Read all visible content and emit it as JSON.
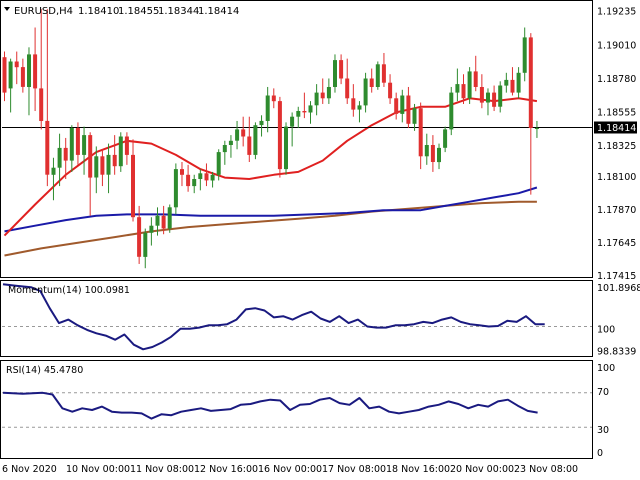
{
  "header": {
    "symbol": "EURUSD,H4",
    "open": "1.18410",
    "high": "1.18455",
    "low": "1.18344",
    "close": "1.18414"
  },
  "chart_data": {
    "type": "candlestick",
    "price_axis": {
      "ticks": [
        "1.19235",
        "1.19010",
        "1.18780",
        "1.18555",
        "1.18325",
        "1.18100",
        "1.17870",
        "1.17645",
        "1.17415"
      ],
      "current_price_label": "1.18414",
      "current_price": 1.18414,
      "ylim": [
        1.17365,
        1.193
      ]
    },
    "x_labels": [
      "6 Nov 2020",
      "10 Nov 00:00",
      "11 Nov 08:00",
      "12 Nov 16:00",
      "16 Nov 00:00",
      "17 Nov 08:00",
      "18 Nov 16:00",
      "20 Nov 00:00",
      "23 Nov 08:00"
    ],
    "colors": {
      "bull": "#2e8b2e",
      "bear": "#e03030",
      "ma_fast": "#e02020",
      "ma_mid": "#1a1aa8",
      "ma_slow": "#a05a2c",
      "indicator": "#1a1a80",
      "level_line": "#000000"
    },
    "candles": [
      [
        1.1891,
        1.1895,
        1.186,
        1.1866
      ],
      [
        1.1869,
        1.189,
        1.1852,
        1.1888
      ],
      [
        1.1888,
        1.1895,
        1.1872,
        1.1884
      ],
      [
        1.1884,
        1.189,
        1.1866,
        1.187
      ],
      [
        1.187,
        1.1898,
        1.185,
        1.1893
      ],
      [
        1.1893,
        1.1912,
        1.1853,
        1.1869
      ],
      [
        1.1869,
        1.1925,
        1.184,
        1.1846
      ],
      [
        1.1846,
        1.1925,
        1.18,
        1.1808
      ],
      [
        1.1808,
        1.182,
        1.179,
        1.1813
      ],
      [
        1.1813,
        1.1837,
        1.18,
        1.1827
      ],
      [
        1.1827,
        1.1834,
        1.1805,
        1.1818
      ],
      [
        1.1818,
        1.1843,
        1.181,
        1.1841
      ],
      [
        1.1841,
        1.1845,
        1.1815,
        1.1822
      ],
      [
        1.1822,
        1.1842,
        1.1808,
        1.1836
      ],
      [
        1.1836,
        1.1838,
        1.1779,
        1.1806
      ],
      [
        1.1806,
        1.1828,
        1.1795,
        1.1821
      ],
      [
        1.1821,
        1.1826,
        1.18,
        1.1808
      ],
      [
        1.1808,
        1.183,
        1.1795,
        1.1822
      ],
      [
        1.1822,
        1.1836,
        1.1808,
        1.1814
      ],
      [
        1.1814,
        1.1838,
        1.181,
        1.1835
      ],
      [
        1.1835,
        1.1838,
        1.1815,
        1.1822
      ],
      [
        1.1822,
        1.1833,
        1.1775,
        1.1778
      ],
      [
        1.1778,
        1.1786,
        1.1745,
        1.175
      ],
      [
        1.175,
        1.177,
        1.1742,
        1.1767
      ],
      [
        1.1767,
        1.1778,
        1.1758,
        1.1772
      ],
      [
        1.1772,
        1.1785,
        1.1765,
        1.1779
      ],
      [
        1.1779,
        1.1786,
        1.1766,
        1.177
      ],
      [
        1.177,
        1.1787,
        1.1767,
        1.1785
      ],
      [
        1.1785,
        1.1816,
        1.178,
        1.1812
      ],
      [
        1.1812,
        1.1817,
        1.18,
        1.1808
      ],
      [
        1.1808,
        1.1815,
        1.1796,
        1.18
      ],
      [
        1.18,
        1.1808,
        1.1795,
        1.1805
      ],
      [
        1.1805,
        1.1812,
        1.1797,
        1.1809
      ],
      [
        1.1809,
        1.1816,
        1.18,
        1.1804
      ],
      [
        1.1804,
        1.181,
        1.1799,
        1.1808
      ],
      [
        1.1808,
        1.1826,
        1.1804,
        1.1824
      ],
      [
        1.1824,
        1.1832,
        1.1815,
        1.1829
      ],
      [
        1.1829,
        1.1836,
        1.182,
        1.1832
      ],
      [
        1.1832,
        1.1846,
        1.1826,
        1.184
      ],
      [
        1.184,
        1.1849,
        1.1828,
        1.1835
      ],
      [
        1.1835,
        1.1849,
        1.1817,
        1.1822
      ],
      [
        1.1822,
        1.1845,
        1.1819,
        1.1843
      ],
      [
        1.1843,
        1.185,
        1.1835,
        1.1846
      ],
      [
        1.1846,
        1.187,
        1.1838,
        1.1864
      ],
      [
        1.1864,
        1.1869,
        1.1855,
        1.186
      ],
      [
        1.186,
        1.1863,
        1.1806,
        1.1812
      ],
      [
        1.1812,
        1.1845,
        1.1808,
        1.1842
      ],
      [
        1.1842,
        1.1852,
        1.1828,
        1.1849
      ],
      [
        1.1849,
        1.1856,
        1.1841,
        1.1853
      ],
      [
        1.1853,
        1.1866,
        1.1848,
        1.1852
      ],
      [
        1.1852,
        1.186,
        1.1844,
        1.1857
      ],
      [
        1.1857,
        1.1872,
        1.185,
        1.1866
      ],
      [
        1.1866,
        1.1876,
        1.1858,
        1.1862
      ],
      [
        1.1862,
        1.1876,
        1.1858,
        1.187
      ],
      [
        1.187,
        1.1893,
        1.1866,
        1.1889
      ],
      [
        1.1889,
        1.1893,
        1.1872,
        1.1876
      ],
      [
        1.1876,
        1.189,
        1.1858,
        1.1862
      ],
      [
        1.1862,
        1.1872,
        1.1849,
        1.1854
      ],
      [
        1.1854,
        1.186,
        1.1845,
        1.1857
      ],
      [
        1.1857,
        1.188,
        1.1852,
        1.1876
      ],
      [
        1.1876,
        1.1883,
        1.1866,
        1.187
      ],
      [
        1.187,
        1.1888,
        1.1868,
        1.1886
      ],
      [
        1.1886,
        1.1894,
        1.187,
        1.1873
      ],
      [
        1.1873,
        1.1879,
        1.1858,
        1.1862
      ],
      [
        1.1862,
        1.1866,
        1.1847,
        1.1851
      ],
      [
        1.1851,
        1.1868,
        1.1845,
        1.1864
      ],
      [
        1.1864,
        1.187,
        1.1841,
        1.1844
      ],
      [
        1.1844,
        1.1858,
        1.1839,
        1.1855
      ],
      [
        1.1855,
        1.1859,
        1.1812,
        1.1821
      ],
      [
        1.1821,
        1.1837,
        1.1815,
        1.1829
      ],
      [
        1.1829,
        1.1836,
        1.181,
        1.1817
      ],
      [
        1.1817,
        1.183,
        1.1812,
        1.1827
      ],
      [
        1.1827,
        1.1842,
        1.1824,
        1.184
      ],
      [
        1.184,
        1.187,
        1.1836,
        1.1866
      ],
      [
        1.1866,
        1.1883,
        1.186,
        1.1872
      ],
      [
        1.1872,
        1.1879,
        1.1858,
        1.1862
      ],
      [
        1.1862,
        1.1884,
        1.1858,
        1.1881
      ],
      [
        1.1881,
        1.1892,
        1.1867,
        1.187
      ],
      [
        1.187,
        1.1879,
        1.1855,
        1.1859
      ],
      [
        1.1859,
        1.1869,
        1.185,
        1.1866
      ],
      [
        1.1866,
        1.1871,
        1.1853,
        1.1856
      ],
      [
        1.1856,
        1.1874,
        1.1852,
        1.1871
      ],
      [
        1.1871,
        1.188,
        1.1866,
        1.1875
      ],
      [
        1.1875,
        1.1884,
        1.1864,
        1.1866
      ],
      [
        1.1866,
        1.1884,
        1.1862,
        1.188
      ],
      [
        1.188,
        1.1912,
        1.1874,
        1.1905
      ],
      [
        1.1905,
        1.1908,
        1.1794,
        1.1841
      ],
      [
        1.1841,
        1.1846,
        1.1834,
        1.1841
      ]
    ],
    "ma_fast": [
      [
        0,
        1.1765
      ],
      [
        5,
        1.1787
      ],
      [
        10,
        1.1808
      ],
      [
        15,
        1.1824
      ],
      [
        20,
        1.1832
      ],
      [
        24,
        1.183
      ],
      [
        28,
        1.1822
      ],
      [
        32,
        1.1812
      ],
      [
        36,
        1.1806
      ],
      [
        40,
        1.1805
      ],
      [
        44,
        1.1808
      ],
      [
        48,
        1.181
      ],
      [
        52,
        1.1818
      ],
      [
        56,
        1.1832
      ],
      [
        60,
        1.1843
      ],
      [
        64,
        1.1852
      ],
      [
        68,
        1.1856
      ],
      [
        72,
        1.1856
      ],
      [
        76,
        1.1862
      ],
      [
        80,
        1.186
      ],
      [
        84,
        1.1862
      ],
      [
        87,
        1.186
      ]
    ],
    "ma_mid": [
      [
        0,
        1.1768
      ],
      [
        5,
        1.1772
      ],
      [
        10,
        1.1776
      ],
      [
        15,
        1.1779
      ],
      [
        20,
        1.178
      ],
      [
        26,
        1.178
      ],
      [
        32,
        1.1779
      ],
      [
        38,
        1.1779
      ],
      [
        44,
        1.1779
      ],
      [
        50,
        1.178
      ],
      [
        56,
        1.1781
      ],
      [
        62,
        1.1783
      ],
      [
        68,
        1.1783
      ],
      [
        72,
        1.1786
      ],
      [
        76,
        1.1789
      ],
      [
        80,
        1.1792
      ],
      [
        84,
        1.1795
      ],
      [
        87,
        1.1799
      ]
    ],
    "ma_slow": [
      [
        0,
        1.1751
      ],
      [
        6,
        1.1756
      ],
      [
        12,
        1.176
      ],
      [
        18,
        1.1764
      ],
      [
        24,
        1.1768
      ],
      [
        30,
        1.1771
      ],
      [
        36,
        1.1773
      ],
      [
        42,
        1.1775
      ],
      [
        48,
        1.1777
      ],
      [
        54,
        1.1779
      ],
      [
        60,
        1.1782
      ],
      [
        66,
        1.1784
      ],
      [
        72,
        1.1786
      ],
      [
        78,
        1.1788
      ],
      [
        84,
        1.1789
      ],
      [
        87,
        1.1789
      ]
    ],
    "momentum": {
      "label": "Momentum(14) 100.0981",
      "ticks": [
        "101.8968",
        "100",
        "98.8339"
      ],
      "ylim": [
        98.75,
        101.95
      ],
      "baseline": 100,
      "values": [
        [
          0,
          101.85
        ],
        [
          3,
          101.78
        ],
        [
          6,
          101.72
        ],
        [
          8,
          101.55
        ],
        [
          10,
          100.8
        ],
        [
          12,
          100.15
        ],
        [
          14,
          100.3
        ],
        [
          16,
          100.05
        ],
        [
          18,
          99.85
        ],
        [
          20,
          99.7
        ],
        [
          22,
          99.6
        ],
        [
          24,
          99.42
        ],
        [
          26,
          99.65
        ],
        [
          28,
          99.2
        ],
        [
          30,
          99.0
        ],
        [
          32,
          99.1
        ],
        [
          34,
          99.3
        ],
        [
          36,
          99.55
        ],
        [
          38,
          99.9
        ],
        [
          40,
          99.9
        ],
        [
          42,
          99.95
        ],
        [
          44,
          100.05
        ],
        [
          46,
          100.05
        ],
        [
          48,
          100.1
        ],
        [
          50,
          100.3
        ],
        [
          52,
          100.75
        ],
        [
          54,
          100.8
        ],
        [
          56,
          100.7
        ],
        [
          58,
          100.4
        ],
        [
          60,
          100.45
        ],
        [
          62,
          100.3
        ],
        [
          64,
          100.5
        ],
        [
          66,
          100.65
        ],
        [
          68,
          100.35
        ],
        [
          70,
          100.2
        ],
        [
          72,
          100.45
        ],
        [
          74,
          100.15
        ],
        [
          76,
          100.3
        ],
        [
          78,
          100.0
        ],
        [
          80,
          99.95
        ],
        [
          82,
          99.95
        ],
        [
          84,
          100.05
        ],
        [
          86,
          100.05
        ],
        [
          88,
          100.1
        ],
        [
          90,
          100.2
        ],
        [
          92,
          100.15
        ],
        [
          94,
          100.3
        ],
        [
          96,
          100.4
        ],
        [
          98,
          100.2
        ],
        [
          100,
          100.1
        ],
        [
          102,
          100.05
        ],
        [
          104,
          100.0
        ],
        [
          106,
          100.02
        ],
        [
          108,
          100.25
        ],
        [
          110,
          100.2
        ],
        [
          112,
          100.45
        ],
        [
          114,
          100.1
        ],
        [
          116,
          100.1
        ]
      ]
    },
    "rsi": {
      "label": "RSI(14) 45.4780",
      "ticks": [
        "100",
        "70",
        "30",
        "0"
      ],
      "levels": [
        70,
        30
      ],
      "ylim": [
        0,
        100
      ],
      "values": [
        [
          0,
          70
        ],
        [
          4,
          69
        ],
        [
          8,
          70
        ],
        [
          10,
          68
        ],
        [
          12,
          52
        ],
        [
          14,
          48
        ],
        [
          16,
          52
        ],
        [
          18,
          50
        ],
        [
          20,
          54
        ],
        [
          22,
          48
        ],
        [
          24,
          47
        ],
        [
          26,
          47
        ],
        [
          28,
          46
        ],
        [
          30,
          40
        ],
        [
          32,
          45
        ],
        [
          34,
          44
        ],
        [
          36,
          48
        ],
        [
          38,
          50
        ],
        [
          40,
          52
        ],
        [
          42,
          49
        ],
        [
          44,
          50
        ],
        [
          46,
          51
        ],
        [
          48,
          56
        ],
        [
          50,
          57
        ],
        [
          52,
          60
        ],
        [
          54,
          62
        ],
        [
          56,
          61
        ],
        [
          58,
          50
        ],
        [
          60,
          56
        ],
        [
          62,
          57
        ],
        [
          64,
          62
        ],
        [
          66,
          64
        ],
        [
          68,
          58
        ],
        [
          70,
          56
        ],
        [
          72,
          64
        ],
        [
          74,
          52
        ],
        [
          76,
          54
        ],
        [
          78,
          48
        ],
        [
          80,
          46
        ],
        [
          82,
          48
        ],
        [
          84,
          50
        ],
        [
          86,
          54
        ],
        [
          88,
          56
        ],
        [
          90,
          60
        ],
        [
          92,
          57
        ],
        [
          94,
          52
        ],
        [
          96,
          56
        ],
        [
          98,
          54
        ],
        [
          100,
          60
        ],
        [
          102,
          62
        ],
        [
          104,
          55
        ],
        [
          106,
          49
        ],
        [
          108,
          47
        ]
      ]
    }
  }
}
